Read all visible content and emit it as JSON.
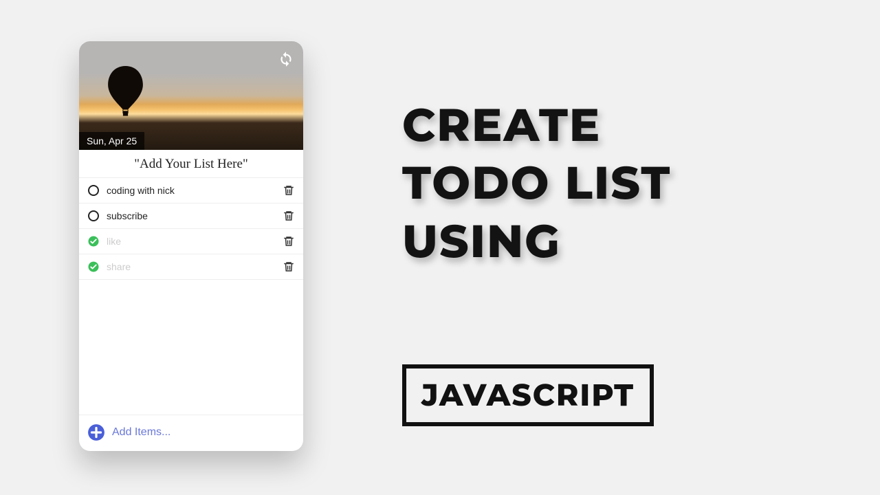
{
  "card": {
    "date": "Sun, Apr 25",
    "prompt": "\"Add Your List Here\"",
    "add_placeholder": "Add Items...",
    "items": [
      {
        "label": "coding with nick",
        "done": false
      },
      {
        "label": "subscribe",
        "done": false
      },
      {
        "label": "like",
        "done": true
      },
      {
        "label": "share",
        "done": true
      }
    ]
  },
  "headline": {
    "line1": "CREATE",
    "line2": "TODO LIST",
    "line3": "USING",
    "box": "JAVASCRIPT"
  },
  "colors": {
    "accent": "#4a5fd8",
    "done_check": "#3bbf5a"
  }
}
